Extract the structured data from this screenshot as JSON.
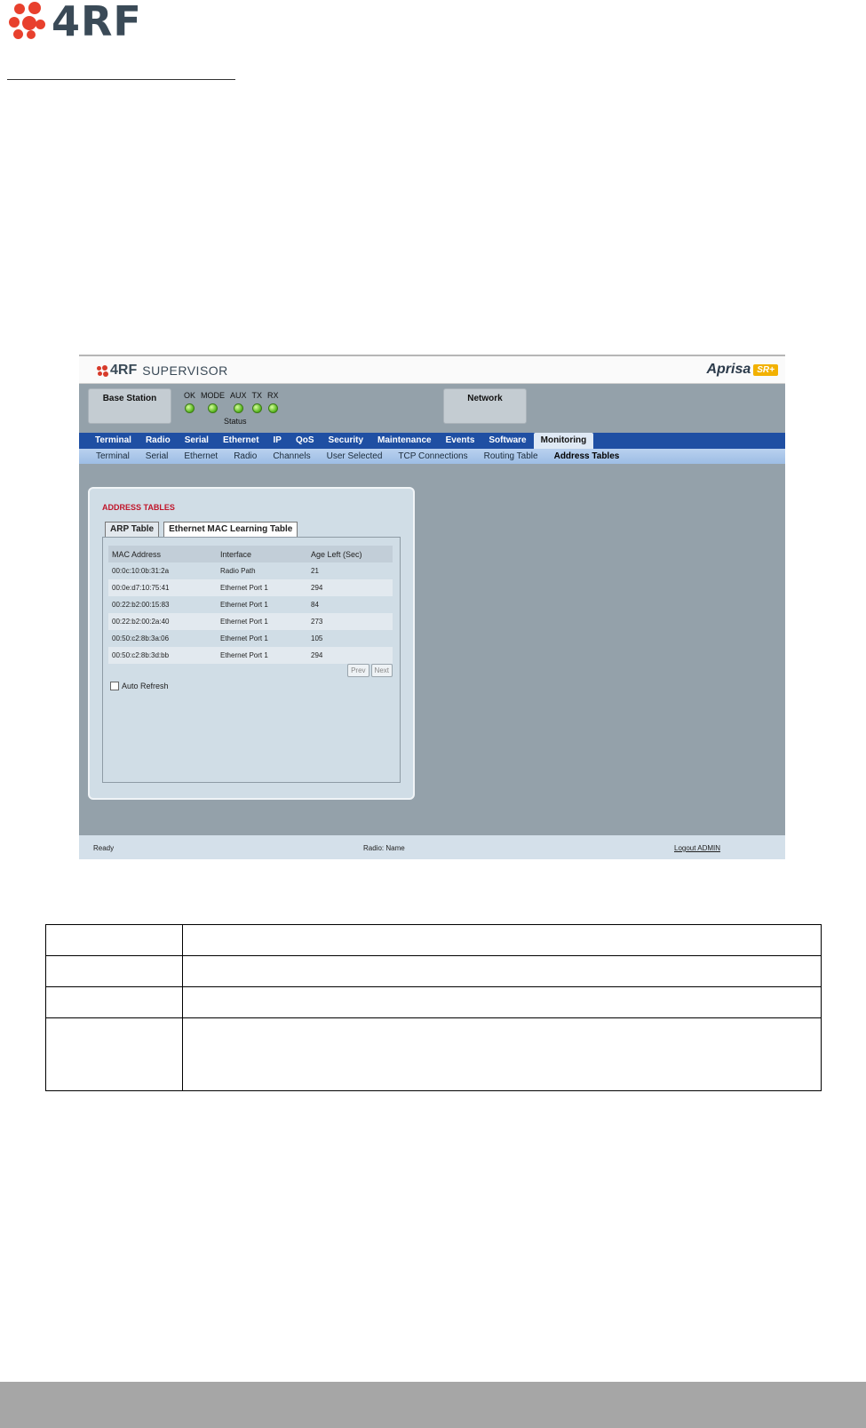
{
  "logo": {
    "text": "4RF"
  },
  "app": {
    "brand": {
      "company": "4RF",
      "product": "SUPERVISOR",
      "right_logo": "Aprisa",
      "right_badge": "SR+"
    },
    "status": {
      "station": "Base Station",
      "network": "Network",
      "caption": "Status",
      "leds": [
        {
          "label": "OK",
          "state": "green"
        },
        {
          "label": "MODE",
          "state": "green"
        },
        {
          "label": "AUX",
          "state": "green"
        },
        {
          "label": "TX",
          "state": "green"
        },
        {
          "label": "RX",
          "state": "green"
        }
      ]
    },
    "main_nav": [
      "Terminal",
      "Radio",
      "Serial",
      "Ethernet",
      "IP",
      "QoS",
      "Security",
      "Maintenance",
      "Events",
      "Software",
      "Monitoring"
    ],
    "main_nav_active": "Monitoring",
    "sub_nav": [
      "Terminal",
      "Serial",
      "Ethernet",
      "Radio",
      "Channels",
      "User Selected",
      "TCP Connections",
      "Routing Table",
      "Address Tables"
    ],
    "sub_nav_active": "Address Tables",
    "panel": {
      "title": "ADDRESS TABLES",
      "tabs": [
        "ARP Table",
        "Ethernet MAC Learning Table"
      ],
      "active_tab": "Ethernet MAC Learning Table",
      "columns": [
        "MAC Address",
        "Interface",
        "Age Left (Sec)"
      ],
      "rows": [
        [
          "00:0c:10:0b:31:2a",
          "Radio Path",
          "21"
        ],
        [
          "00:0e:d7:10:75:41",
          "Ethernet Port 1",
          "294"
        ],
        [
          "00:22:b2:00:15:83",
          "Ethernet Port 1",
          "84"
        ],
        [
          "00:22:b2:00:2a:40",
          "Ethernet Port 1",
          "273"
        ],
        [
          "00:50:c2:8b:3a:06",
          "Ethernet Port 1",
          "105"
        ],
        [
          "00:50:c2:8b:3d:bb",
          "Ethernet Port 1",
          "294"
        ]
      ],
      "prev_label": "Prev",
      "next_label": "Next",
      "auto_refresh_label": "Auto Refresh",
      "auto_refresh_checked": false
    },
    "footer": {
      "status": "Ready",
      "radio_name": "Radio: Name",
      "logout": "Logout ADMIN"
    }
  },
  "colors": {
    "brand_red": "#e8402d",
    "nav_blue": "#1f4fa3",
    "panel_title_red": "#c0152a",
    "led_green": "#53b21c"
  }
}
